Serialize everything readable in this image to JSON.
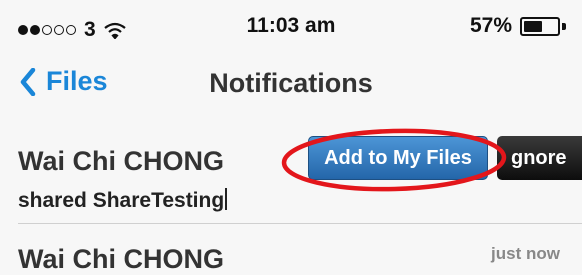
{
  "status_bar": {
    "signal_dots_filled": 2,
    "signal_dots_total": 5,
    "carrier": "3",
    "time": "11:03 am",
    "battery_text": "57%",
    "battery_level": 0.57,
    "icons": [
      "signal-dots-icon",
      "wifi-icon",
      "battery-icon"
    ]
  },
  "nav": {
    "back_label": "Files",
    "title": "Notifications",
    "accent_color": "#1a86d8"
  },
  "notifications": [
    {
      "sender": "Wai Chi CHONG",
      "message": "shared ShareTesting",
      "accept_label": "Add to My Files",
      "ignore_label": "gnore"
    },
    {
      "sender": "Wai Chi CHONG",
      "timestamp": "just now"
    }
  ],
  "annotation": {
    "highlight_color": "#e3161b",
    "highlight_shape": "ellipse"
  }
}
